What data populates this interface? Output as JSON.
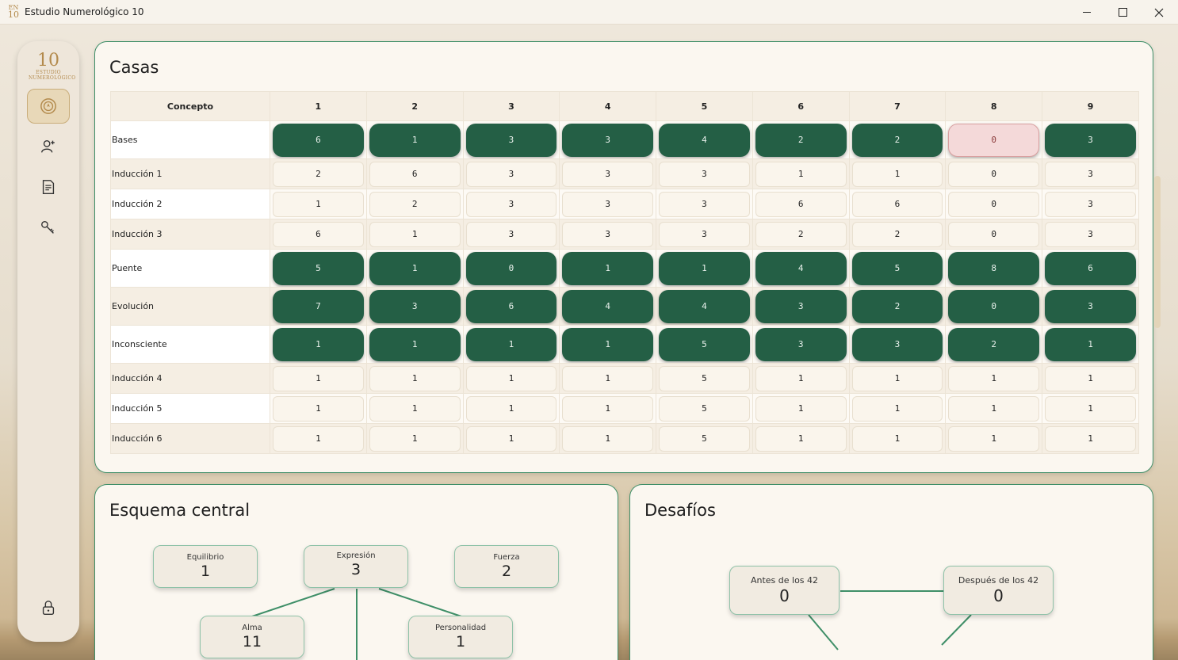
{
  "window": {
    "title": "Estudio Numerológico 10",
    "icon_top": "EN",
    "icon_bottom": "10"
  },
  "sidebar": {
    "logo_big": "10",
    "logo_line1": "ESTUDIO",
    "logo_line2": "NUMEROLÓGICO",
    "items": [
      {
        "icon": "compass-icon",
        "active": true
      },
      {
        "icon": "user-add-icon",
        "active": false
      },
      {
        "icon": "document-icon",
        "active": false
      },
      {
        "icon": "key-icon",
        "active": false
      }
    ],
    "bottom_icon": "lock-icon"
  },
  "casas": {
    "title": "Casas",
    "header": [
      "Concepto",
      "1",
      "2",
      "3",
      "4",
      "5",
      "6",
      "7",
      "8",
      "9"
    ],
    "rows": [
      {
        "label": "Bases",
        "style": "pill",
        "values": [
          "6",
          "1",
          "3",
          "3",
          "4",
          "2",
          "2",
          "0",
          "3"
        ],
        "warn_index": 7
      },
      {
        "label": "Inducción 1",
        "style": "box",
        "values": [
          "2",
          "6",
          "3",
          "3",
          "3",
          "1",
          "1",
          "0",
          "3"
        ]
      },
      {
        "label": "Inducción 2",
        "style": "box",
        "values": [
          "1",
          "2",
          "3",
          "3",
          "3",
          "6",
          "6",
          "0",
          "3"
        ]
      },
      {
        "label": "Inducción 3",
        "style": "box",
        "values": [
          "6",
          "1",
          "3",
          "3",
          "3",
          "2",
          "2",
          "0",
          "3"
        ]
      },
      {
        "label": "Puente",
        "style": "pill",
        "values": [
          "5",
          "1",
          "0",
          "1",
          "1",
          "4",
          "5",
          "8",
          "6"
        ]
      },
      {
        "label": "Evolución",
        "style": "pill",
        "values": [
          "7",
          "3",
          "6",
          "4",
          "4",
          "3",
          "2",
          "0",
          "3"
        ]
      },
      {
        "label": "Inconsciente",
        "style": "pill",
        "values": [
          "1",
          "1",
          "1",
          "1",
          "5",
          "3",
          "3",
          "2",
          "1"
        ]
      },
      {
        "label": "Inducción 4",
        "style": "box",
        "values": [
          "1",
          "1",
          "1",
          "1",
          "5",
          "1",
          "1",
          "1",
          "1"
        ]
      },
      {
        "label": "Inducción 5",
        "style": "box",
        "values": [
          "1",
          "1",
          "1",
          "1",
          "5",
          "1",
          "1",
          "1",
          "1"
        ]
      },
      {
        "label": "Inducción 6",
        "style": "box",
        "values": [
          "1",
          "1",
          "1",
          "1",
          "5",
          "1",
          "1",
          "1",
          "1"
        ]
      }
    ]
  },
  "esquema": {
    "title": "Esquema central",
    "equilibrio": {
      "label": "Equilibrio",
      "value": "1"
    },
    "expresion": {
      "label": "Expresión",
      "value": "3"
    },
    "fuerza": {
      "label": "Fuerza",
      "value": "2"
    },
    "alma": {
      "label": "Alma",
      "value": "11"
    },
    "personalidad": {
      "label": "Personalidad",
      "value": "1"
    }
  },
  "desafios": {
    "title": "Desafíos",
    "antes": {
      "label": "Antes de los 42",
      "value": "0"
    },
    "despues": {
      "label": "Después de los 42",
      "value": "0"
    }
  },
  "colors": {
    "accent_green": "#245f45",
    "warn_pink": "#f4d9d9",
    "border_green": "#3f8f68",
    "gold": "#b38a4c"
  }
}
